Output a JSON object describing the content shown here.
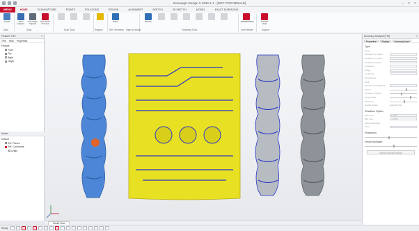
{
  "window": {
    "title": "Geomagic Design X 2022.1.1 - [NOT FOR RESALE]"
  },
  "menu_label": "MENU",
  "tabs": [
    "HOME",
    "SCANCAPTURE",
    "POINTS",
    "POLYGONS",
    "REGION",
    "ALIGNMENT",
    "SKETCH",
    "3D SKETCH",
    "MODEL",
    "EXACT SURFACING"
  ],
  "ribbon": {
    "buttons": [
      {
        "label": "Import",
        "color": "#4a7fc1"
      },
      {
        "label": "Scan Capture",
        "color": "#3b6db3"
      },
      {
        "label": "Geomagic Capture",
        "color": "#5e6b7a"
      },
      {
        "label": "Run Scan Process",
        "color": "#c8102e"
      },
      {
        "label": "Auto Segment",
        "color": "#e6b800"
      },
      {
        "label": "Plane",
        "color": "#2f6fb5"
      },
      {
        "label": "Sketch",
        "color": "#2f6fb5"
      },
      {
        "label": "3DSENSORS",
        "color": "#c8102e"
      },
      {
        "label": "Contact Help",
        "color": "#c8102e"
      }
    ],
    "groups": [
      "Data",
      "Scan",
      "Scan Tools",
      "Regions",
      "Ref. Geometry",
      "Align for Model",
      "Modeling Tools",
      "LiveTransfer",
      "Support"
    ]
  },
  "left_panel": {
    "title": "Feature Tree",
    "subtabs": [
      "Tree",
      "Help",
      "Properties"
    ],
    "feature_label": "Feature",
    "planes": [
      "Front",
      "Top",
      "Right"
    ],
    "origin": "Origin",
    "model_title": "Model",
    "model_default": "Default",
    "model_items": [
      "Ref. Planes",
      "Ref. Coordinate"
    ],
    "model_origin": "Origin"
  },
  "right_panel": {
    "title": "Accuracy Analyzer(TM)",
    "tabs": [
      "Properties",
      "Display",
      "Accuracy Anal."
    ],
    "type_header": "Type",
    "type_rows": [
      "None",
      "Deviation For Mesh",
      "Deviation For Body",
      "Surface Curvature",
      "Curvature",
      "Ridge",
      "Continuity",
      "Smoothness",
      "Draft",
      "Environment Mapping",
      "Isoline",
      "Isolation"
    ],
    "options": [
      "Number of Colors",
      "Single Width"
    ],
    "sub_options": [
      "Tolerance",
      "Enable Edges",
      "Edges/Points"
    ],
    "deviation_header": "Deviation Option",
    "dev_rows": [
      "Max. Dev.",
      "Min. Dev."
    ],
    "dev_values": [
      "1.0000",
      "-1.0000"
    ],
    "ignore_label": "Ignore Boundary",
    "color_label": "Color",
    "resolution_label": "Resolution",
    "vector_label": "Vector Multiplier",
    "button_label": "Select Selected Range"
  },
  "view_tab": "Model View",
  "status": {
    "label": "Ready",
    "ribbon": "Cloud"
  },
  "colors": {
    "accent": "#c8102e",
    "scan_blue": "#4d86d6",
    "deviation_yellow": "#e8e022",
    "mesh_gray": "#9aa0a6",
    "curve_blue": "#2936c9"
  }
}
